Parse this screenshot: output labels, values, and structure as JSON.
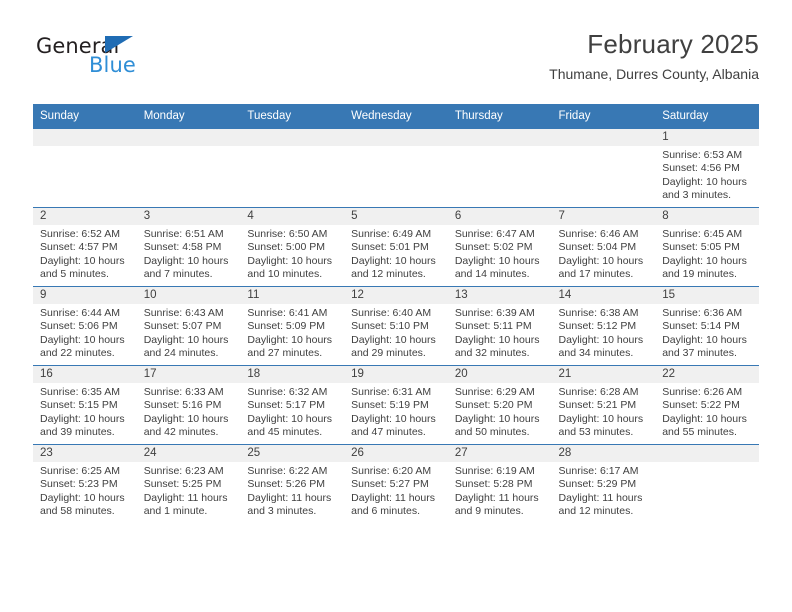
{
  "brand": {
    "name_part1": "General",
    "name_part2": "Blue",
    "triangle_color": "#1f6cb4",
    "blue_text_color": "#2f8ed6"
  },
  "header": {
    "title": "February 2025",
    "subtitle": "Thumane, Durres County, Albania"
  },
  "theme": {
    "header_bg": "#3878b4",
    "header_text": "#ffffff",
    "daynum_band_bg": "#f0f0f0",
    "body_text": "#404040",
    "grid_line": "#3878b4"
  },
  "weekday_headers": [
    "Sunday",
    "Monday",
    "Tuesday",
    "Wednesday",
    "Thursday",
    "Friday",
    "Saturday"
  ],
  "labels": {
    "sunrise_prefix": "Sunrise:",
    "sunset_prefix": "Sunset:",
    "daylight_prefix": "Daylight:"
  },
  "weeks": [
    [
      {
        "day": "",
        "sunrise": "",
        "sunset": "",
        "daylight_line1": "",
        "daylight_line2": "",
        "empty": true
      },
      {
        "day": "",
        "sunrise": "",
        "sunset": "",
        "daylight_line1": "",
        "daylight_line2": "",
        "empty": true
      },
      {
        "day": "",
        "sunrise": "",
        "sunset": "",
        "daylight_line1": "",
        "daylight_line2": "",
        "empty": true
      },
      {
        "day": "",
        "sunrise": "",
        "sunset": "",
        "daylight_line1": "",
        "daylight_line2": "",
        "empty": true
      },
      {
        "day": "",
        "sunrise": "",
        "sunset": "",
        "daylight_line1": "",
        "daylight_line2": "",
        "empty": true
      },
      {
        "day": "",
        "sunrise": "",
        "sunset": "",
        "daylight_line1": "",
        "daylight_line2": "",
        "empty": true
      },
      {
        "day": "1",
        "sunrise": "Sunrise: 6:53 AM",
        "sunset": "Sunset: 4:56 PM",
        "daylight_line1": "Daylight: 10 hours",
        "daylight_line2": "and 3 minutes.",
        "empty": false
      }
    ],
    [
      {
        "day": "2",
        "sunrise": "Sunrise: 6:52 AM",
        "sunset": "Sunset: 4:57 PM",
        "daylight_line1": "Daylight: 10 hours",
        "daylight_line2": "and 5 minutes.",
        "empty": false
      },
      {
        "day": "3",
        "sunrise": "Sunrise: 6:51 AM",
        "sunset": "Sunset: 4:58 PM",
        "daylight_line1": "Daylight: 10 hours",
        "daylight_line2": "and 7 minutes.",
        "empty": false
      },
      {
        "day": "4",
        "sunrise": "Sunrise: 6:50 AM",
        "sunset": "Sunset: 5:00 PM",
        "daylight_line1": "Daylight: 10 hours",
        "daylight_line2": "and 10 minutes.",
        "empty": false
      },
      {
        "day": "5",
        "sunrise": "Sunrise: 6:49 AM",
        "sunset": "Sunset: 5:01 PM",
        "daylight_line1": "Daylight: 10 hours",
        "daylight_line2": "and 12 minutes.",
        "empty": false
      },
      {
        "day": "6",
        "sunrise": "Sunrise: 6:47 AM",
        "sunset": "Sunset: 5:02 PM",
        "daylight_line1": "Daylight: 10 hours",
        "daylight_line2": "and 14 minutes.",
        "empty": false
      },
      {
        "day": "7",
        "sunrise": "Sunrise: 6:46 AM",
        "sunset": "Sunset: 5:04 PM",
        "daylight_line1": "Daylight: 10 hours",
        "daylight_line2": "and 17 minutes.",
        "empty": false
      },
      {
        "day": "8",
        "sunrise": "Sunrise: 6:45 AM",
        "sunset": "Sunset: 5:05 PM",
        "daylight_line1": "Daylight: 10 hours",
        "daylight_line2": "and 19 minutes.",
        "empty": false
      }
    ],
    [
      {
        "day": "9",
        "sunrise": "Sunrise: 6:44 AM",
        "sunset": "Sunset: 5:06 PM",
        "daylight_line1": "Daylight: 10 hours",
        "daylight_line2": "and 22 minutes.",
        "empty": false
      },
      {
        "day": "10",
        "sunrise": "Sunrise: 6:43 AM",
        "sunset": "Sunset: 5:07 PM",
        "daylight_line1": "Daylight: 10 hours",
        "daylight_line2": "and 24 minutes.",
        "empty": false
      },
      {
        "day": "11",
        "sunrise": "Sunrise: 6:41 AM",
        "sunset": "Sunset: 5:09 PM",
        "daylight_line1": "Daylight: 10 hours",
        "daylight_line2": "and 27 minutes.",
        "empty": false
      },
      {
        "day": "12",
        "sunrise": "Sunrise: 6:40 AM",
        "sunset": "Sunset: 5:10 PM",
        "daylight_line1": "Daylight: 10 hours",
        "daylight_line2": "and 29 minutes.",
        "empty": false
      },
      {
        "day": "13",
        "sunrise": "Sunrise: 6:39 AM",
        "sunset": "Sunset: 5:11 PM",
        "daylight_line1": "Daylight: 10 hours",
        "daylight_line2": "and 32 minutes.",
        "empty": false
      },
      {
        "day": "14",
        "sunrise": "Sunrise: 6:38 AM",
        "sunset": "Sunset: 5:12 PM",
        "daylight_line1": "Daylight: 10 hours",
        "daylight_line2": "and 34 minutes.",
        "empty": false
      },
      {
        "day": "15",
        "sunrise": "Sunrise: 6:36 AM",
        "sunset": "Sunset: 5:14 PM",
        "daylight_line1": "Daylight: 10 hours",
        "daylight_line2": "and 37 minutes.",
        "empty": false
      }
    ],
    [
      {
        "day": "16",
        "sunrise": "Sunrise: 6:35 AM",
        "sunset": "Sunset: 5:15 PM",
        "daylight_line1": "Daylight: 10 hours",
        "daylight_line2": "and 39 minutes.",
        "empty": false
      },
      {
        "day": "17",
        "sunrise": "Sunrise: 6:33 AM",
        "sunset": "Sunset: 5:16 PM",
        "daylight_line1": "Daylight: 10 hours",
        "daylight_line2": "and 42 minutes.",
        "empty": false
      },
      {
        "day": "18",
        "sunrise": "Sunrise: 6:32 AM",
        "sunset": "Sunset: 5:17 PM",
        "daylight_line1": "Daylight: 10 hours",
        "daylight_line2": "and 45 minutes.",
        "empty": false
      },
      {
        "day": "19",
        "sunrise": "Sunrise: 6:31 AM",
        "sunset": "Sunset: 5:19 PM",
        "daylight_line1": "Daylight: 10 hours",
        "daylight_line2": "and 47 minutes.",
        "empty": false
      },
      {
        "day": "20",
        "sunrise": "Sunrise: 6:29 AM",
        "sunset": "Sunset: 5:20 PM",
        "daylight_line1": "Daylight: 10 hours",
        "daylight_line2": "and 50 minutes.",
        "empty": false
      },
      {
        "day": "21",
        "sunrise": "Sunrise: 6:28 AM",
        "sunset": "Sunset: 5:21 PM",
        "daylight_line1": "Daylight: 10 hours",
        "daylight_line2": "and 53 minutes.",
        "empty": false
      },
      {
        "day": "22",
        "sunrise": "Sunrise: 6:26 AM",
        "sunset": "Sunset: 5:22 PM",
        "daylight_line1": "Daylight: 10 hours",
        "daylight_line2": "and 55 minutes.",
        "empty": false
      }
    ],
    [
      {
        "day": "23",
        "sunrise": "Sunrise: 6:25 AM",
        "sunset": "Sunset: 5:23 PM",
        "daylight_line1": "Daylight: 10 hours",
        "daylight_line2": "and 58 minutes.",
        "empty": false
      },
      {
        "day": "24",
        "sunrise": "Sunrise: 6:23 AM",
        "sunset": "Sunset: 5:25 PM",
        "daylight_line1": "Daylight: 11 hours",
        "daylight_line2": "and 1 minute.",
        "empty": false
      },
      {
        "day": "25",
        "sunrise": "Sunrise: 6:22 AM",
        "sunset": "Sunset: 5:26 PM",
        "daylight_line1": "Daylight: 11 hours",
        "daylight_line2": "and 3 minutes.",
        "empty": false
      },
      {
        "day": "26",
        "sunrise": "Sunrise: 6:20 AM",
        "sunset": "Sunset: 5:27 PM",
        "daylight_line1": "Daylight: 11 hours",
        "daylight_line2": "and 6 minutes.",
        "empty": false
      },
      {
        "day": "27",
        "sunrise": "Sunrise: 6:19 AM",
        "sunset": "Sunset: 5:28 PM",
        "daylight_line1": "Daylight: 11 hours",
        "daylight_line2": "and 9 minutes.",
        "empty": false
      },
      {
        "day": "28",
        "sunrise": "Sunrise: 6:17 AM",
        "sunset": "Sunset: 5:29 PM",
        "daylight_line1": "Daylight: 11 hours",
        "daylight_line2": "and 12 minutes.",
        "empty": false
      },
      {
        "day": "",
        "sunrise": "",
        "sunset": "",
        "daylight_line1": "",
        "daylight_line2": "",
        "empty": true
      }
    ]
  ]
}
